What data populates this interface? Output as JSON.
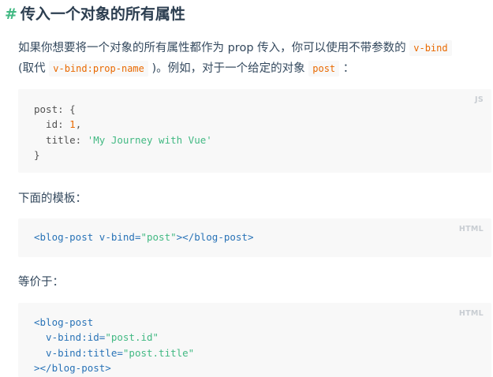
{
  "heading": {
    "hash": "#",
    "title": "传入一个对象的所有属性"
  },
  "intro": {
    "part1": "如果你想要将一个对象的所有属性都作为 prop 传入，你可以使用不带参数的",
    "code1": "v-bind",
    "part2": "(取代",
    "code2": "v-bind:prop-name",
    "part3": ")。例如，对于一个给定的对象",
    "code3": "post",
    "part4": "："
  },
  "block1": {
    "lang": "JS",
    "l1": "post: {",
    "l2_key": "  id: ",
    "l2_num": "1",
    "l2_end": ",",
    "l3_key": "  title: ",
    "l3_str": "'My Journey with Vue'",
    "l4": "}"
  },
  "template_label": "下面的模板：",
  "block2": {
    "lang": "HTML",
    "open_tag": "<blog-post",
    "attr": " v-bind=",
    "val": "\"post\"",
    "close_tag": "></blog-post>"
  },
  "equiv_label": "等价于：",
  "block3": {
    "lang": "HTML",
    "l1": "<blog-post",
    "l2_attr": "  v-bind:id=",
    "l2_val": "\"post.id\"",
    "l3_attr": "  v-bind:title=",
    "l3_val": "\"post.title\"",
    "l4": "></blog-post>"
  }
}
